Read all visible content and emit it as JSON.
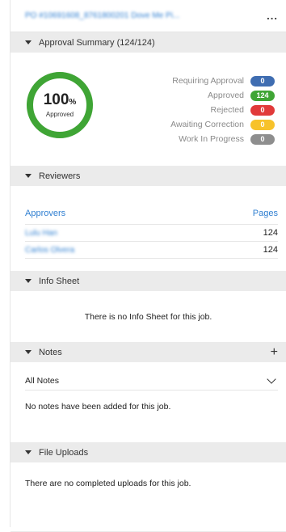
{
  "header": {
    "job_title": "PO #10691608_8761800201 Dove Me Pi...",
    "more_icon": "ellipsis-icon",
    "more_label": "..."
  },
  "approval_summary": {
    "title": "Approval Summary (124/124)",
    "percent": "100",
    "percent_sign": "%",
    "percent_label": "Approved",
    "progress_fraction": 1.0,
    "ring_color": "#3fa535",
    "statuses": [
      {
        "label": "Requiring Approval",
        "count": "0",
        "color": "#3f6db1"
      },
      {
        "label": "Approved",
        "count": "124",
        "color": "#3fa535"
      },
      {
        "label": "Rejected",
        "count": "0",
        "color": "#e13a3a"
      },
      {
        "label": "Awaiting Correction",
        "count": "0",
        "color": "#f7c22b"
      },
      {
        "label": "Work In Progress",
        "count": "0",
        "color": "#8e8e8e"
      }
    ]
  },
  "reviewers": {
    "title": "Reviewers",
    "col_approvers": "Approvers",
    "col_pages": "Pages",
    "rows": [
      {
        "name": "Lulu Han",
        "pages": "124"
      },
      {
        "name": "Carlos Olvera",
        "pages": "124"
      }
    ]
  },
  "info_sheet": {
    "title": "Info Sheet",
    "empty_text": "There is no Info Sheet for this job."
  },
  "notes": {
    "title": "Notes",
    "add_label": "+",
    "filter_value": "All Notes",
    "empty_text": "No notes have been added for this job."
  },
  "file_uploads": {
    "title": "File Uploads",
    "empty_text": "There are no completed uploads for this job."
  }
}
